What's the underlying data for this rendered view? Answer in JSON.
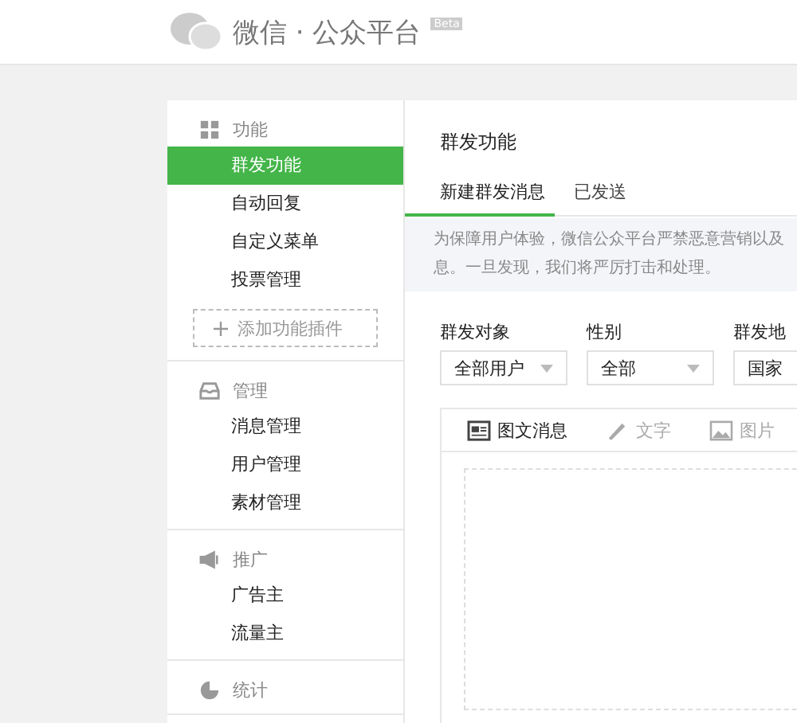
{
  "header": {
    "logo_text": "微信 · 公众平台",
    "badge": "Beta"
  },
  "sidebar": {
    "sections": [
      {
        "title": "功能",
        "items": [
          {
            "label": "群发功能",
            "selected": true
          },
          {
            "label": "自动回复",
            "selected": false
          },
          {
            "label": "自定义菜单",
            "selected": false
          },
          {
            "label": "投票管理",
            "selected": false
          }
        ],
        "add_button": "添加功能插件"
      },
      {
        "title": "管理",
        "items": [
          {
            "label": "消息管理",
            "selected": false
          },
          {
            "label": "用户管理",
            "selected": false
          },
          {
            "label": "素材管理",
            "selected": false
          }
        ]
      },
      {
        "title": "推广",
        "items": [
          {
            "label": "广告主",
            "selected": false
          },
          {
            "label": "流量主",
            "selected": false
          }
        ]
      },
      {
        "title": "统计"
      }
    ]
  },
  "content": {
    "title": "群发功能",
    "tabs": [
      {
        "label": "新建群发消息",
        "selected": true
      },
      {
        "label": "已发送",
        "selected": false
      }
    ],
    "notice": [
      "为保障用户体验，微信公众平台严禁恶意营销以及",
      "息。一旦发现，我们将严厉打击和处理。"
    ],
    "filters": [
      {
        "label": "群发对象",
        "value": "全部用户"
      },
      {
        "label": "性别",
        "value": "全部"
      },
      {
        "label": "群发地",
        "value": "国家"
      }
    ],
    "editor_tabs": [
      {
        "label": "图文消息",
        "selected": true
      },
      {
        "label": "文字",
        "selected": false
      },
      {
        "label": "图片",
        "selected": false
      }
    ]
  }
}
